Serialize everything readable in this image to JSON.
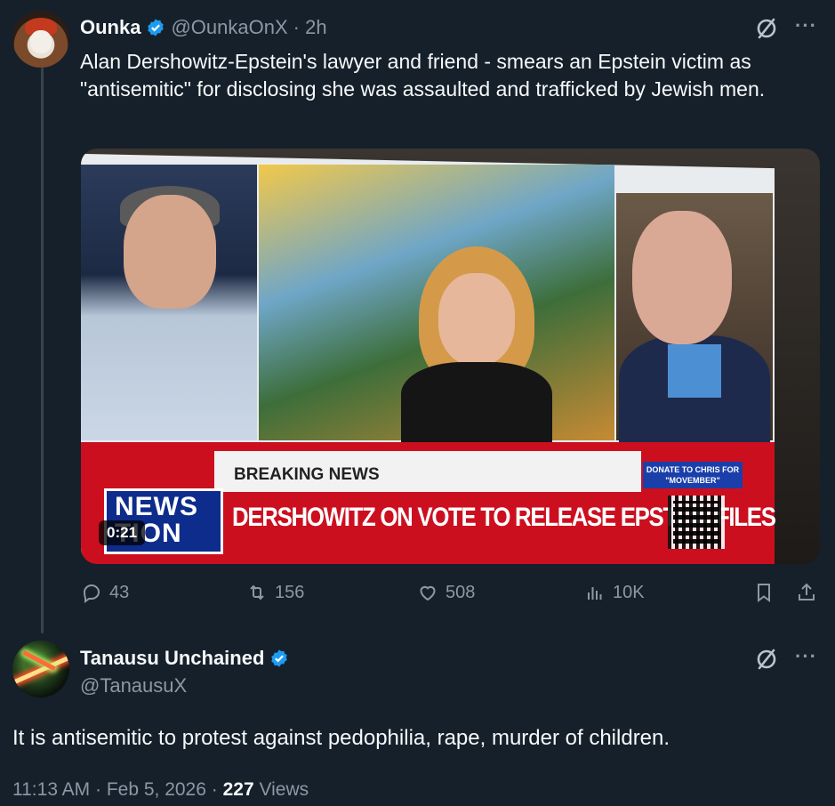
{
  "tweet": {
    "name": "Ounka",
    "handle": "@OunkaOnX",
    "time": "· 2h",
    "text": "Alan Dershowitz-Epstein's lawyer and friend - smears an Epstein victim as \"antisemitic\" for disclosing she was assaulted and trafficked by Jewish men.",
    "media": {
      "breaking_label": "BREAKING NEWS",
      "headline": "DERSHOWITZ ON VOTE TO RELEASE EPSTEIN FILES",
      "network_line1": "NEWS",
      "network_line2": "TION",
      "donate_text": "DONATE TO CHRIS FOR \"MOVEMBER\"",
      "video_time": "0:21"
    },
    "actions": {
      "replies": "43",
      "reposts": "156",
      "likes": "508",
      "views": "10K"
    }
  },
  "reply": {
    "name": "Tanausu Unchained",
    "handle": "@TanausuX",
    "text": "It is antisemitic to protest against pedophilia, rape, murder of children.",
    "timestamp": "11:13 AM · Feb 5, 2026 ·",
    "views_count": "227",
    "views_label": "Views"
  },
  "icons": {
    "verified": "verified-badge-icon",
    "grok": "grok-icon",
    "more": "more-icon",
    "reply": "reply-icon",
    "repost": "repost-icon",
    "like": "heart-icon",
    "views": "views-icon",
    "bookmark": "bookmark-icon",
    "share": "share-icon"
  },
  "colors": {
    "background": "#15202b",
    "text": "#f7f9f9",
    "muted": "#8b98a5",
    "verified": "#1d9bf0"
  }
}
